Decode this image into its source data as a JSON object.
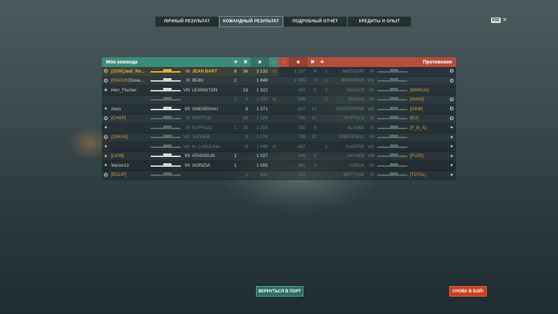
{
  "tabs": [
    {
      "label": "ЛИЧНЫЙ РЕЗУЛЬТАТ",
      "active": false
    },
    {
      "label": "КОМАНДНЫЙ РЕЗУЛЬТАТ",
      "active": true
    },
    {
      "label": "ПОДРОБНЫЙ ОТЧЁТ",
      "active": false
    },
    {
      "label": "КРЕДИТЫ И ОПЫТ",
      "active": false
    }
  ],
  "esc": {
    "key": "ESC",
    "close": "✕"
  },
  "ally": {
    "title": "Моя команда",
    "rows": [
      {
        "rank": "✪",
        "clan": "[DDM]",
        "name": "Jedi_Re...",
        "tier": "IX",
        "ship": "JEAN BART",
        "planes": "6",
        "frags": "36",
        "xp": "3 132",
        "face": "☺",
        "me": true,
        "dead": false
      },
      {
        "rank": "✪",
        "clan": "[SNOOK]",
        "name": "Gusa...",
        "tier": "IX",
        "ship": "IBUKI",
        "planes": "2",
        "frags": "",
        "xp": "1 848",
        "face": "",
        "me": false,
        "dead": false
      },
      {
        "rank": "★",
        "clan": "",
        "name": "Herr_Fischer",
        "tier": "VIII",
        "ship": "LEXINGTON",
        "planes": "",
        "frags": "13",
        "xp": "1 322",
        "face": "",
        "me": false,
        "dead": false
      },
      {
        "rank": "",
        "clan": "",
        "name": "",
        "tier": "",
        "ship": "",
        "planes": "1",
        "frags": "3",
        "xp": "1 300",
        "face": "☺",
        "me": false,
        "dead": true
      },
      {
        "rank": "✦",
        "clan": "",
        "name": "Aloin",
        "tier": "VII",
        "ship": "GNEISENAU",
        "planes": "",
        "frags": "3",
        "xp": "1 271",
        "face": "",
        "me": false,
        "dead": false
      },
      {
        "rank": "✪",
        "clan": "[CHAP]",
        "name": "",
        "tier": "IX",
        "ship": "SEATTLE",
        "planes": "",
        "frags": "16",
        "xp": "1 229",
        "face": "",
        "me": false,
        "dead": true
      },
      {
        "rank": "✦",
        "clan": "",
        "name": "",
        "tier": "IX",
        "ship": "BUFFALO",
        "planes": "1",
        "frags": "25",
        "xp": "1 219",
        "face": "",
        "me": false,
        "dead": true
      },
      {
        "rank": "✪",
        "clan": "[31RUS]",
        "name": "",
        "tier": "VIII",
        "ship": "ЧАПАЕВ",
        "planes": "",
        "frags": "3",
        "xp": "1 074",
        "face": "",
        "me": false,
        "dead": true
      },
      {
        "rank": "✦",
        "clan": "",
        "name": "",
        "tier": "VIII",
        "ship": "N. CAROLINA",
        "planes": "",
        "frags": "6",
        "xp": "1 045",
        "face": "☺",
        "me": false,
        "dead": true
      },
      {
        "rank": "✦",
        "clan": "[LION]",
        "name": "",
        "tier": "VII",
        "ship": "ATAGO/LIN",
        "planes": "1",
        "frags": "",
        "xp": "1 027",
        "face": "",
        "me": false,
        "dead": false
      },
      {
        "rank": "✦",
        "clan": "",
        "name": "Warior13",
        "tier": "VII",
        "ship": "GORIZIA",
        "planes": "1",
        "frags": "",
        "xp": "1 005",
        "face": "",
        "me": false,
        "dead": false
      },
      {
        "rank": "✪",
        "clan": "[ECLIP]",
        "name": "",
        "tier": "",
        "ship": "",
        "planes": "",
        "frags": "1",
        "xp": "541",
        "face": "",
        "me": false,
        "dead": true
      }
    ]
  },
  "enemy": {
    "title": "Противники",
    "rows": [
      {
        "face": "",
        "xp": "1 157",
        "frags": "4",
        "planes": "1",
        "ship": "MISSOURI",
        "tier": "IX",
        "name": "",
        "clan": "",
        "rank": "✪",
        "dead": true
      },
      {
        "face": "",
        "xp": "1 045",
        "frags": "3",
        "planes": "1",
        "ship": "BISMARCK",
        "tier": "VIII",
        "name": "",
        "clan": "",
        "rank": "✪",
        "dead": true
      },
      {
        "face": "",
        "xp": "991",
        "frags": "5",
        "planes": "2",
        "ship": "NAGATO",
        "tier": "VII",
        "name": "",
        "clan": "[WNRUA]",
        "rank": "",
        "dead": true
      },
      {
        "face": "",
        "xp": "926",
        "frags": "",
        "planes": "2",
        "ship": "MAHAN",
        "tier": "VII",
        "name": "",
        "clan": "[AVAM]",
        "rank": "✪",
        "dead": true
      },
      {
        "face": "",
        "xp": "837",
        "frags": "12",
        "planes": "",
        "ship": "ENTERPRISE",
        "tier": "VIII",
        "name": "",
        "clan": "[GRIB]",
        "rank": "✪",
        "dead": true
      },
      {
        "face": "",
        "xp": "785",
        "frags": "11",
        "planes": "",
        "ship": "BUFFALO",
        "tier": "IX",
        "name": "",
        "clan": "[KU]",
        "rank": "✪",
        "dead": true
      },
      {
        "face": "",
        "xp": "781",
        "frags": "6",
        "planes": "",
        "ship": "ALASKA",
        "tier": "IX",
        "name": "",
        "clan": "[P_B_A]",
        "rank": "✦",
        "dead": true
      },
      {
        "face": "",
        "xp": "749",
        "frags": "10",
        "planes": "",
        "ship": "GNEISENAU",
        "tier": "VII",
        "name": "",
        "clan": "",
        "rank": "✦",
        "dead": true
      },
      {
        "face": "",
        "xp": "667",
        "frags": "",
        "planes": "1",
        "ship": "KAGERO",
        "tier": "VIII",
        "name": "",
        "clan": "",
        "rank": "✦",
        "dead": true
      },
      {
        "face": "",
        "xp": "548",
        "frags": "5",
        "planes": "",
        "ship": "ЧАПАЕВ",
        "tier": "VIII",
        "name": "",
        "clan": "[FUZE]",
        "rank": "✦",
        "dead": true
      },
      {
        "face": "",
        "xp": "491",
        "frags": "3",
        "planes": "",
        "ship": "YORCK",
        "tier": "VII",
        "name": "",
        "clan": "",
        "rank": "✦",
        "dead": true
      },
      {
        "face": "",
        "xp": "321",
        "frags": "",
        "planes": "",
        "ship": "NEPTUNE",
        "tier": "IX",
        "name": "",
        "clan": "[TOTAL]",
        "rank": "✦",
        "dead": true
      }
    ]
  },
  "headers": {
    "planes": "✈",
    "frags": "✖",
    "xp": "★",
    "face": "☺"
  },
  "buttons": {
    "port": "ВЕРНУТЬСЯ В ПОРТ",
    "battle": "СНОВА В БОЙ!"
  }
}
